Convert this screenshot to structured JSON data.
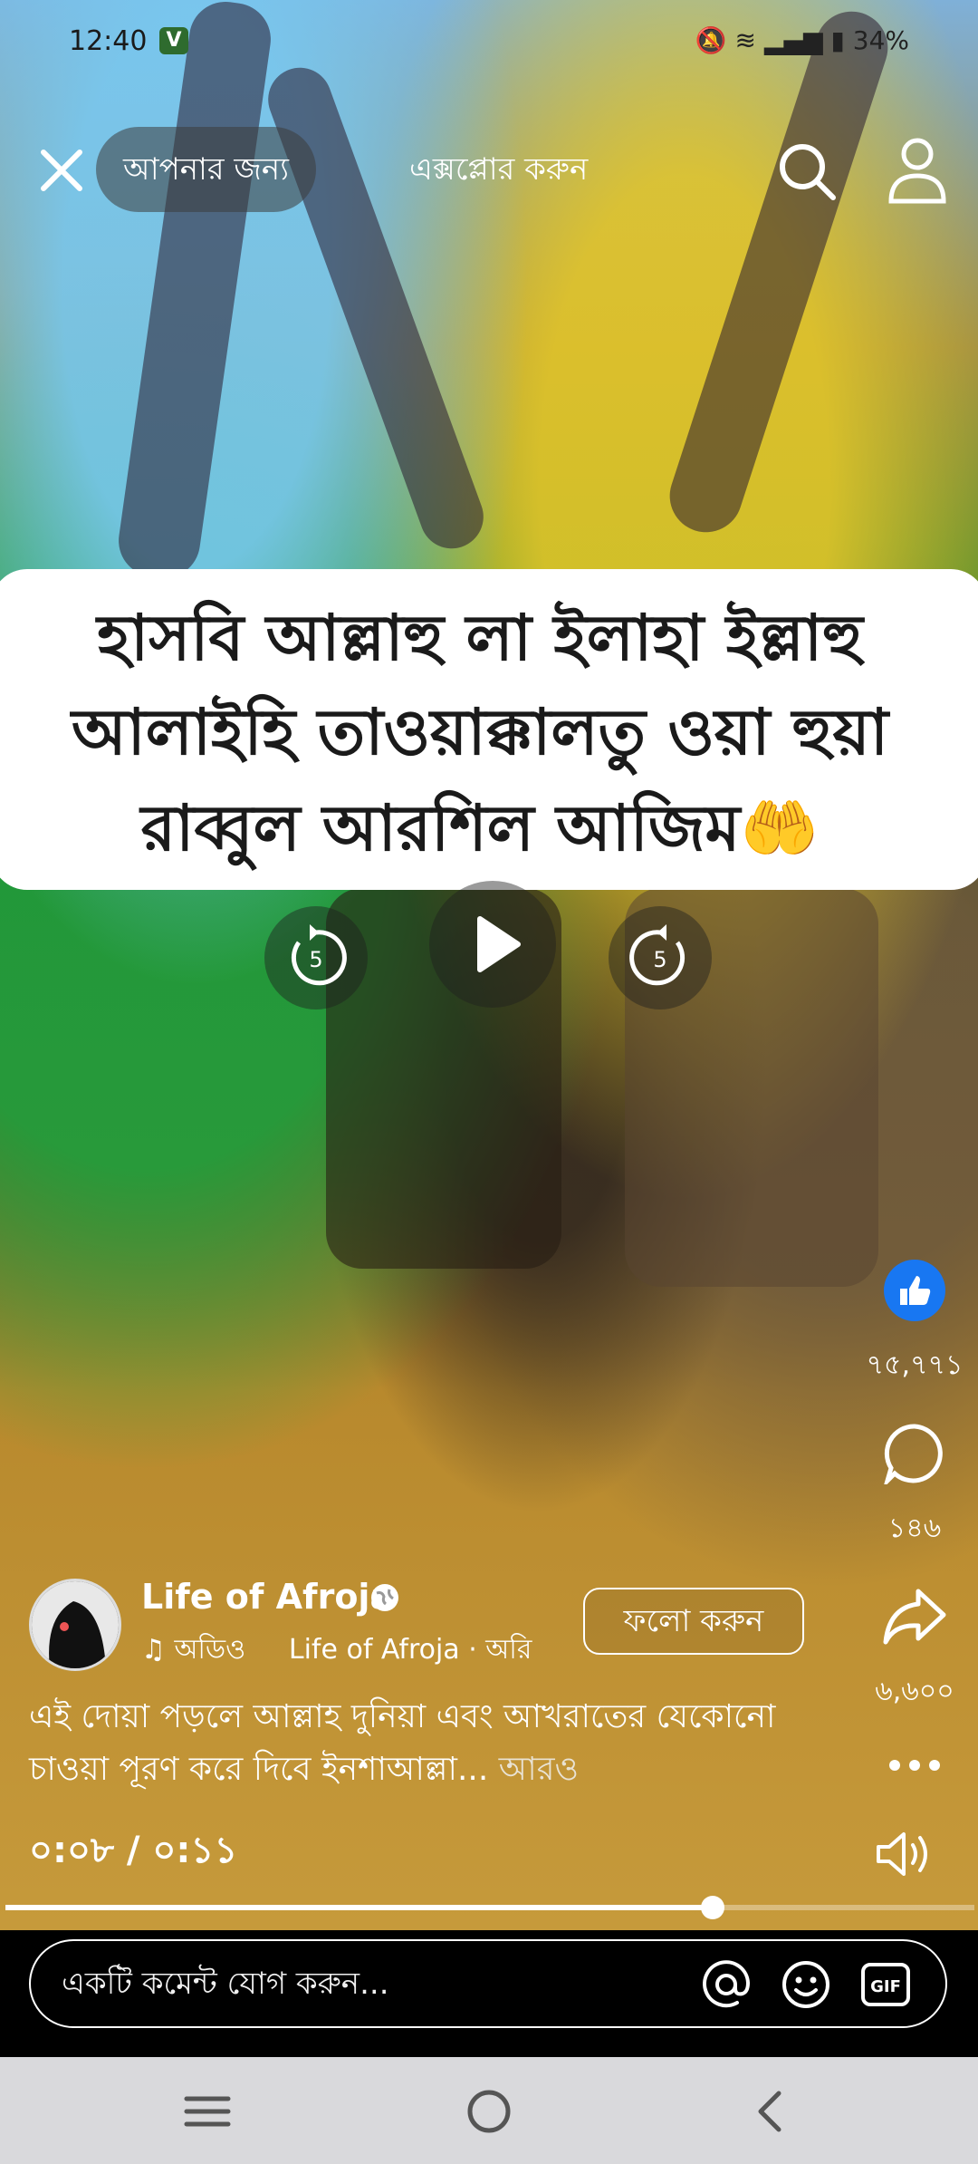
{
  "status_bar": {
    "time": "12:40",
    "app_badge": "V",
    "battery": "34%"
  },
  "top_nav": {
    "for_you_tab": "আপনার জন্য",
    "explore_tab": "এক্সপ্লোর করুন"
  },
  "video_caption": {
    "line1": "হাসবি আল্লাহু লা ইলাহা ইল্লাহু",
    "line2": "আলাইহি তাওয়াক্কালতু ওয়া হুয়া",
    "line3": "রাব্বুল আরশিল আজিম🤲"
  },
  "playback_controls": {
    "rewind_seconds": "5",
    "forward_seconds": "5"
  },
  "engagement": {
    "likes": "৭৫,৭৭১",
    "comments": "১৪৬",
    "shares": "৬,৬০০"
  },
  "author": {
    "name": "Life of Afroja",
    "audio_label": "অডিও",
    "audio_source": "Life of Afroja · অরি",
    "follow_label": "ফলো করুন"
  },
  "description": {
    "text": "এই দোয়া পড়লে আল্লাহ দুনিয়া এবং  আখরাতের যেকোনো চাওয়া পূরণ করে দিবে ইনশাআল্লা... ",
    "more_label": "আরও"
  },
  "player": {
    "time_display": "০:০৮ / ০:১১",
    "progress_fraction": 0.73
  },
  "comment_bar": {
    "placeholder": "একটি কমেন্ট যোগ করুন...",
    "gif_label": "GIF"
  },
  "colors": {
    "like_blue": "#1877f2",
    "caption_bg": "#ffffff",
    "nav_bar_bg": "#d9d9dc"
  }
}
